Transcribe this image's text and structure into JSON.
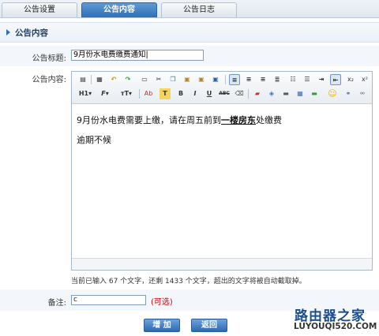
{
  "tabs": [
    {
      "label": "公告设置",
      "active": false
    },
    {
      "label": "公告内容",
      "active": true
    },
    {
      "label": "公告日志",
      "active": false
    }
  ],
  "section": {
    "title": "公告内容"
  },
  "form": {
    "title_label": "公告标题:",
    "title_value": "9月份水电费缴费通知|",
    "content_label": "公告内容:",
    "note_label": "备注:",
    "note_value": "c",
    "note_optional": "(可选)"
  },
  "toolbar": {
    "row1": [
      "source-icon",
      "template-icon",
      "undo-icon",
      "redo-icon",
      "print-icon",
      "cut-icon",
      "copy-icon",
      "paste-icon",
      "paste-text-icon",
      "paste-word-icon",
      "align-left-icon",
      "align-center-icon",
      "align-right-icon",
      "align-justify-icon",
      "ordered-list-icon",
      "unordered-list-icon",
      "indent-icon",
      "outdent-icon",
      "subscript-icon",
      "superscript-icon"
    ],
    "row2": [
      "heading-icon",
      "font-family-icon",
      "font-size-icon",
      "font-color-icon",
      "highlight-icon",
      "bold-icon",
      "italic-icon",
      "underline-icon",
      "strikethrough-icon",
      "remove-format-icon",
      "image-icon",
      "flash-icon",
      "media-icon",
      "table-icon",
      "hr-icon",
      "emoticon-icon",
      "link-icon"
    ],
    "labels": {
      "heading": "H1",
      "font_family": "F",
      "font_size": "T",
      "font_color": "Ab",
      "highlight": "T",
      "bold": "B",
      "italic": "I",
      "underline": "U",
      "strike": "ABC",
      "sub": "x₂",
      "sup": "x²"
    }
  },
  "editor": {
    "line1_pre": "9月份水电费需要上缴，请在周五前到",
    "line1_bold": "一楼房东",
    "line1_post": "处缴费",
    "line2": "逾期不候"
  },
  "counter": "当前已输入 67 个文字，还剩 1433 个文字，超出的文字将被自动截取掉。",
  "buttons": {
    "add": "增 加",
    "back": "返回"
  },
  "watermark": {
    "title": "路由器之家",
    "url": "LUYOUQI520.COM"
  },
  "colors": {
    "accent": "#2f6fb5",
    "optional": "#cc0000",
    "watermark": "#1a4e8f"
  }
}
